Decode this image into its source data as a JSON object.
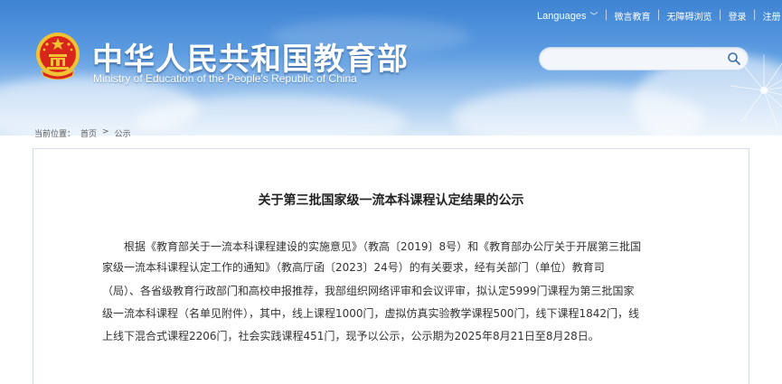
{
  "header": {
    "title_cn": "中华人民共和国教育部",
    "title_en": "Ministry of Education of the People's Republic of China"
  },
  "top_links": {
    "languages": "Languages",
    "weibo": "微言教育",
    "accessibility": "无障碍浏览",
    "login": "登录",
    "register": "注册"
  },
  "search": {
    "placeholder": "",
    "value": ""
  },
  "breadcrumb": {
    "label": "当前位置：",
    "home": "首页",
    "separator": ">",
    "current": "公示"
  },
  "article": {
    "title": "关于第三批国家级一流本科课程认定结果的公示",
    "lines": [
      "根据《教育部关于一流本科课程建设的实施意见》（教高〔2019〕8号）和《教育部办公厅关于开展第三批国",
      "家级一流本科课程认定工作的通知》（教高厅函〔2023〕24号）的有关要求，经有关部门（单位）教育司",
      "（局）、各省级教育行政部门和高校申报推荐，我部组织网络评审和会议评审，拟认定5999门课程为第三批国家",
      "级一流本科课程（名单见附件），其中，线上课程1000门，虚拟仿真实验教学课程500门，线下课程1842门，线",
      "上线下混合式课程2206门，社会实践课程451门，现予以公示，公示期为2025年8月21日至8月28日。"
    ]
  },
  "colors": {
    "sky_top": "#3e83d3",
    "sky_bottom": "#d9e9f8",
    "emblem_red": "#d8261c",
    "emblem_gold": "#f3c233"
  },
  "icons": [
    "emblem-icon",
    "chevron-down-icon",
    "search-icon",
    "dandelion-decoration"
  ]
}
